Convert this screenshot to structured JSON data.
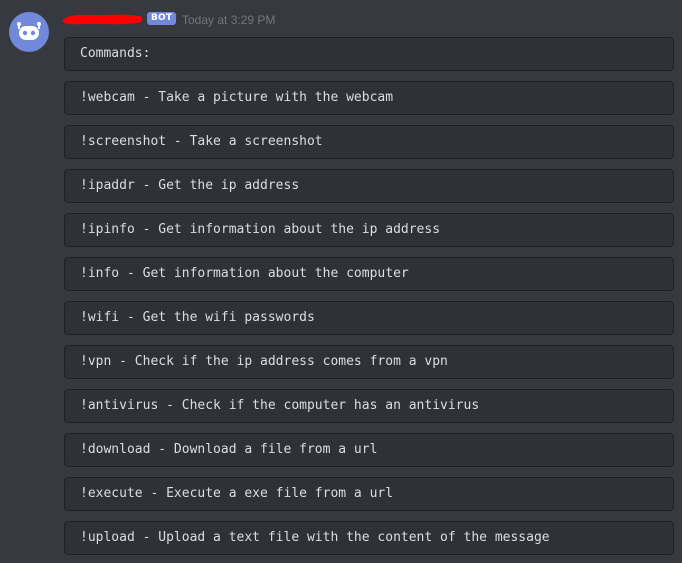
{
  "message": {
    "author_tag": "BOT",
    "timestamp": "Today at 3:29 PM",
    "colors": {
      "background": "#36393f",
      "code_background": "#2f3136",
      "code_border": "#202225",
      "bot_tag": "#7289da",
      "avatar": "#7289da",
      "redaction": "#ff0000"
    },
    "avatar_icon": "discord-bot-avatar-icon",
    "code_blocks": [
      "Commands:",
      "!webcam - Take a picture with the webcam",
      "!screenshot - Take a screenshot",
      "!ipaddr - Get the ip address",
      "!ipinfo - Get information about the ip address",
      "!info - Get information about the computer",
      "!wifi - Get the wifi passwords",
      "!vpn - Check if the ip address comes from a vpn",
      "!antivirus - Check if the computer has an antivirus",
      "!download - Download a file from a url",
      "!execute - Execute a exe file from a url",
      "!upload - Upload a text file with the content of the message"
    ]
  }
}
